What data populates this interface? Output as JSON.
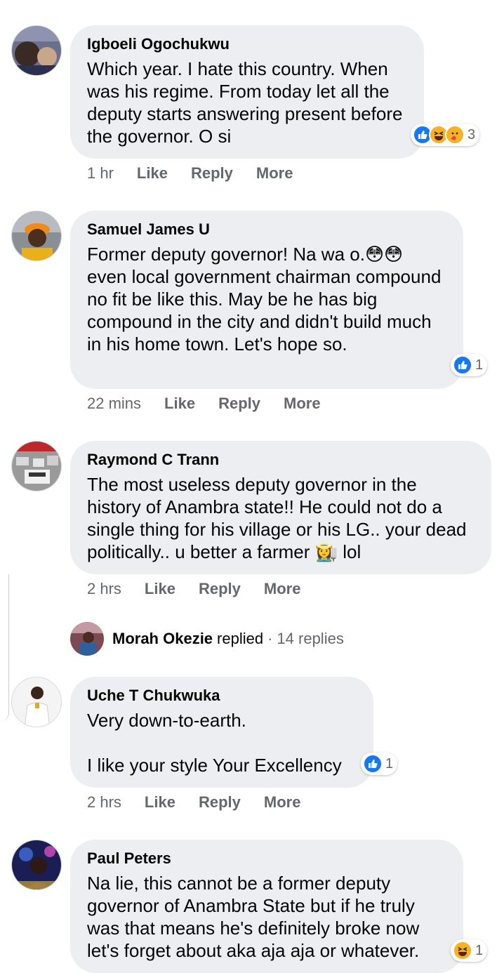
{
  "comments": [
    {
      "author": "Igboeli Ogochukwu",
      "text": "Which year. I hate this country. When was his regime. From today let all the deputy starts answering present before the governor. O si",
      "time": "1 hr",
      "like_label": "Like",
      "reply_label": "Reply",
      "more_label": "More",
      "reaction_count": "3"
    },
    {
      "author": "Samuel James U",
      "text": "Former deputy governor! Na wa o.😳😳 even local government chairman compound no fit be like this. May be he has big compound in the city and didn't build much in his home town. Let's hope so.",
      "time": "22 mins",
      "like_label": "Like",
      "reply_label": "Reply",
      "more_label": "More",
      "reaction_count": "1"
    },
    {
      "author": "Raymond C Trann",
      "text": "The most useless deputy governor in the history of Anambra state!! He could not do a single thing for his village or his LG.. your dead politically.. u better a farmer 👩‍🌾 lol",
      "time": "2 hrs",
      "like_label": "Like",
      "reply_label": "Reply",
      "more_label": "More"
    },
    {
      "author": "Uche T Chukwuka",
      "text": "Very down-to-earth.\n\nI like your style Your Excellency",
      "time": "2 hrs",
      "like_label": "Like",
      "reply_label": "Reply",
      "more_label": "More",
      "reaction_count": "1"
    },
    {
      "author": "Paul Peters",
      "text": "Na lie, this cannot be a former deputy governor of Anambra State but if he truly was that means he's definitely broke now let's forget about aka aja aja or whatever.",
      "reaction_count": "1"
    }
  ],
  "reply_thread": {
    "author": "Morah Okezie",
    "action": "replied",
    "separator": "·",
    "count": "14 replies"
  },
  "colors": {
    "bubble": "#eceef1",
    "meta": "#65676b",
    "like_blue": "#1877f2",
    "emoji_yellow": "#f7b125"
  },
  "icons": [
    "like-reaction-icon",
    "haha-reaction-icon",
    "care-reaction-icon"
  ]
}
